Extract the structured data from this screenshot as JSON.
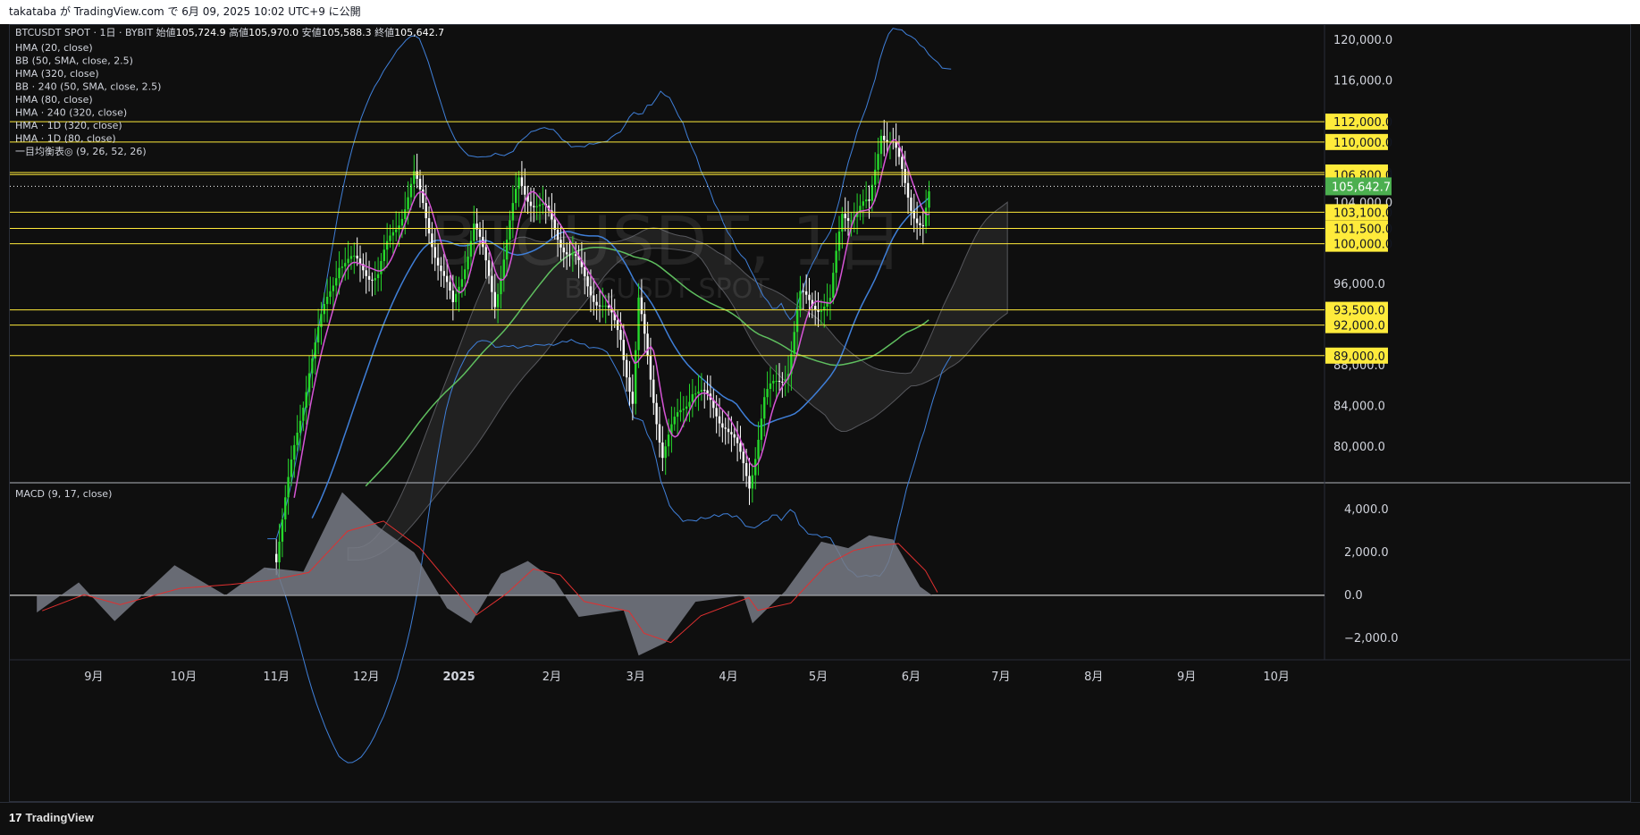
{
  "header": {
    "publish_line": "takataba が TradingView.com で 6月 09, 2025 10:02 UTC+9 に公開"
  },
  "symbol_line": {
    "symbol": "BTCUSDT SPOT · 1日 · BYBIT",
    "open_label": "始値",
    "open": "105,724.9",
    "high_label": "高値",
    "high": "105,970.0",
    "low_label": "安値",
    "low": "105,588.3",
    "close_label": "終値",
    "close": "105,642.7"
  },
  "indicators": [
    "HMA (20, close)",
    "BB (50, SMA, close, 2.5)",
    "HMA (320, close)",
    "BB · 240 (50, SMA, close, 2.5)",
    "HMA (80, close)",
    "HMA · 240 (320, close)",
    "HMA · 1D (320, close)",
    "HMA · 1D (80, close)",
    "一目均衡表◎ (9, 26, 52, 26)"
  ],
  "macd_label": "MACD (9, 17, close)",
  "watermark": {
    "main": "BTCUSDT, 1日",
    "sub": "BTCUSDT SPOT"
  },
  "footer": {
    "brand": "TradingView",
    "logo_text": "17"
  },
  "colors": {
    "up": "#26d92b",
    "down": "#ffffff",
    "hma20": "#d655d6",
    "bb": "#3f7fd8",
    "hma_long": "#5fbf5f",
    "level": "#ffeb3b",
    "current": "#4caf50",
    "macd_area": "#787b86",
    "signal": "#e03030"
  },
  "chart_data": {
    "type": "candlestick",
    "price_axis": {
      "ylim": [
        76500,
        121500
      ],
      "ticks": [
        {
          "value": 120000,
          "label": "120,000.0"
        },
        {
          "value": 116000,
          "label": "116,000.0"
        },
        {
          "value": 104000,
          "label": "104,000.0"
        },
        {
          "value": 96000,
          "label": "96,000.0"
        },
        {
          "value": 88000,
          "label": "88,000.0"
        },
        {
          "value": 84000,
          "label": "84,000.0"
        },
        {
          "value": 80000,
          "label": "80,000.0"
        }
      ]
    },
    "horizontal_levels": [
      {
        "value": 112000,
        "label": "112,000.0"
      },
      {
        "value": 110000,
        "label": "110,000.0"
      },
      {
        "value": 107000,
        "label": "107,000.0"
      },
      {
        "value": 106800,
        "label": "106,800.0"
      },
      {
        "value": 103100,
        "label": "103,100.0"
      },
      {
        "value": 101500,
        "label": "101,500.0"
      },
      {
        "value": 100000,
        "label": "100,000.0"
      },
      {
        "value": 93500,
        "label": "93,500.0"
      },
      {
        "value": 92000,
        "label": "92,000.0"
      },
      {
        "value": 89000,
        "label": "89,000.0"
      }
    ],
    "current_price": {
      "value": 105642.7,
      "label": "105,642.7"
    },
    "time_axis": [
      {
        "label": "9月",
        "bold": false
      },
      {
        "label": "10月",
        "bold": false
      },
      {
        "label": "11月",
        "bold": false
      },
      {
        "label": "12月",
        "bold": false
      },
      {
        "label": "2025",
        "bold": true
      },
      {
        "label": "2月",
        "bold": false
      },
      {
        "label": "3月",
        "bold": false
      },
      {
        "label": "4月",
        "bold": false
      },
      {
        "label": "5月",
        "bold": false
      },
      {
        "label": "6月",
        "bold": false
      },
      {
        "label": "7月",
        "bold": false
      },
      {
        "label": "8月",
        "bold": false
      },
      {
        "label": "9月",
        "bold": false
      },
      {
        "label": "10月",
        "bold": false
      }
    ],
    "closes": [
      {
        "date": "2024-11-01",
        "close": 69500
      },
      {
        "date": "2024-11-12",
        "close": 88000
      },
      {
        "date": "2024-11-22",
        "close": 98500
      },
      {
        "date": "2024-12-05",
        "close": 97000
      },
      {
        "date": "2024-12-17",
        "close": 106500
      },
      {
        "date": "2024-12-30",
        "close": 93500
      },
      {
        "date": "2025-01-06",
        "close": 102000
      },
      {
        "date": "2025-01-13",
        "close": 94500
      },
      {
        "date": "2025-01-21",
        "close": 106000
      },
      {
        "date": "2025-01-31",
        "close": 102500
      },
      {
        "date": "2025-02-10",
        "close": 97500
      },
      {
        "date": "2025-02-24",
        "close": 91000
      },
      {
        "date": "2025-02-28",
        "close": 84500
      },
      {
        "date": "2025-03-02",
        "close": 94000
      },
      {
        "date": "2025-03-10",
        "close": 79500
      },
      {
        "date": "2025-03-20",
        "close": 86000
      },
      {
        "date": "2025-03-31",
        "close": 82500
      },
      {
        "date": "2025-04-08",
        "close": 76500
      },
      {
        "date": "2025-04-13",
        "close": 84500
      },
      {
        "date": "2025-04-21",
        "close": 88000
      },
      {
        "date": "2025-04-25",
        "close": 94500
      },
      {
        "date": "2025-05-05",
        "close": 94000
      },
      {
        "date": "2025-05-09",
        "close": 103000
      },
      {
        "date": "2025-05-18",
        "close": 103500
      },
      {
        "date": "2025-05-22",
        "close": 111500
      },
      {
        "date": "2025-05-26",
        "close": 109500
      },
      {
        "date": "2025-06-01",
        "close": 104000
      },
      {
        "date": "2025-06-05",
        "close": 101500
      },
      {
        "date": "2025-06-08",
        "close": 105642.7
      }
    ],
    "macd": {
      "ylim": [
        -3000,
        5200
      ],
      "ticks": [
        {
          "value": 4000,
          "label": "4,000.0"
        },
        {
          "value": 2000,
          "label": "2,000.0"
        },
        {
          "value": 0,
          "label": "0.0"
        },
        {
          "value": -2000,
          "label": "−2,000.0"
        }
      ],
      "values": [
        {
          "date": "2024-08-13",
          "value": -800
        },
        {
          "date": "2024-08-27",
          "value": 600
        },
        {
          "date": "2024-09-08",
          "value": -1200
        },
        {
          "date": "2024-09-28",
          "value": 1400
        },
        {
          "date": "2024-10-15",
          "value": 0
        },
        {
          "date": "2024-10-28",
          "value": 1300
        },
        {
          "date": "2024-11-10",
          "value": 1100
        },
        {
          "date": "2024-11-23",
          "value": 4800
        },
        {
          "date": "2024-12-05",
          "value": 3200
        },
        {
          "date": "2024-12-17",
          "value": 2000
        },
        {
          "date": "2024-12-28",
          "value": -600
        },
        {
          "date": "2025-01-05",
          "value": -1300
        },
        {
          "date": "2025-01-15",
          "value": 1000
        },
        {
          "date": "2025-01-24",
          "value": 1600
        },
        {
          "date": "2025-02-02",
          "value": 700
        },
        {
          "date": "2025-02-10",
          "value": -1000
        },
        {
          "date": "2025-02-25",
          "value": -700
        },
        {
          "date": "2025-03-02",
          "value": -2800
        },
        {
          "date": "2025-03-11",
          "value": -2200
        },
        {
          "date": "2025-03-21",
          "value": -300
        },
        {
          "date": "2025-04-06",
          "value": 0
        },
        {
          "date": "2025-04-09",
          "value": -1300
        },
        {
          "date": "2025-04-20",
          "value": 200
        },
        {
          "date": "2025-05-02",
          "value": 2500
        },
        {
          "date": "2025-05-11",
          "value": 2200
        },
        {
          "date": "2025-05-18",
          "value": 2800
        },
        {
          "date": "2025-05-26",
          "value": 2600
        },
        {
          "date": "2025-06-04",
          "value": 400
        },
        {
          "date": "2025-06-08",
          "value": 0
        }
      ]
    }
  }
}
